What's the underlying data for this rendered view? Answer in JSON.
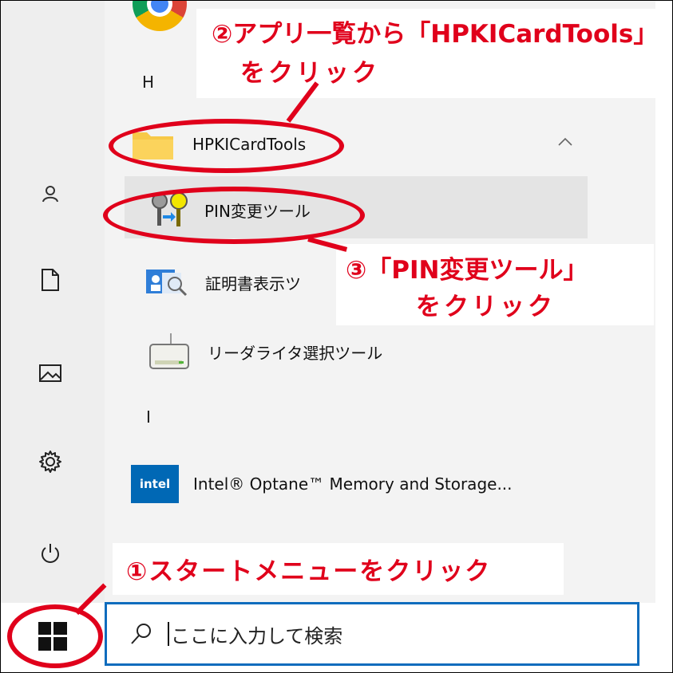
{
  "start_menu": {
    "letter_h": "H",
    "letter_i": "I",
    "folder_label": "HPKICardTools",
    "apps": [
      {
        "label": "PIN変更ツール"
      },
      {
        "label": "証明書表示ツ"
      },
      {
        "label": "リーダライタ選択ツール"
      },
      {
        "label": "Intel® Optane™ Memory and Storage..."
      }
    ],
    "intel_logo": "intel"
  },
  "taskbar": {
    "search_text": "ここに入力して検索"
  },
  "annotations": {
    "step1": "①スタートメニューをクリック",
    "step2_line1": "②アプリ一覧から「HPKICardTools」",
    "step2_line2": "をクリック",
    "step3_line1": "③「PIN変更ツール」",
    "step3_line2": "をクリック"
  },
  "colors": {
    "annotation_red": "#e0001b",
    "search_border": "#0f6cbd",
    "folder_yellow": "#f7c948",
    "intel_blue": "#0068b5"
  }
}
